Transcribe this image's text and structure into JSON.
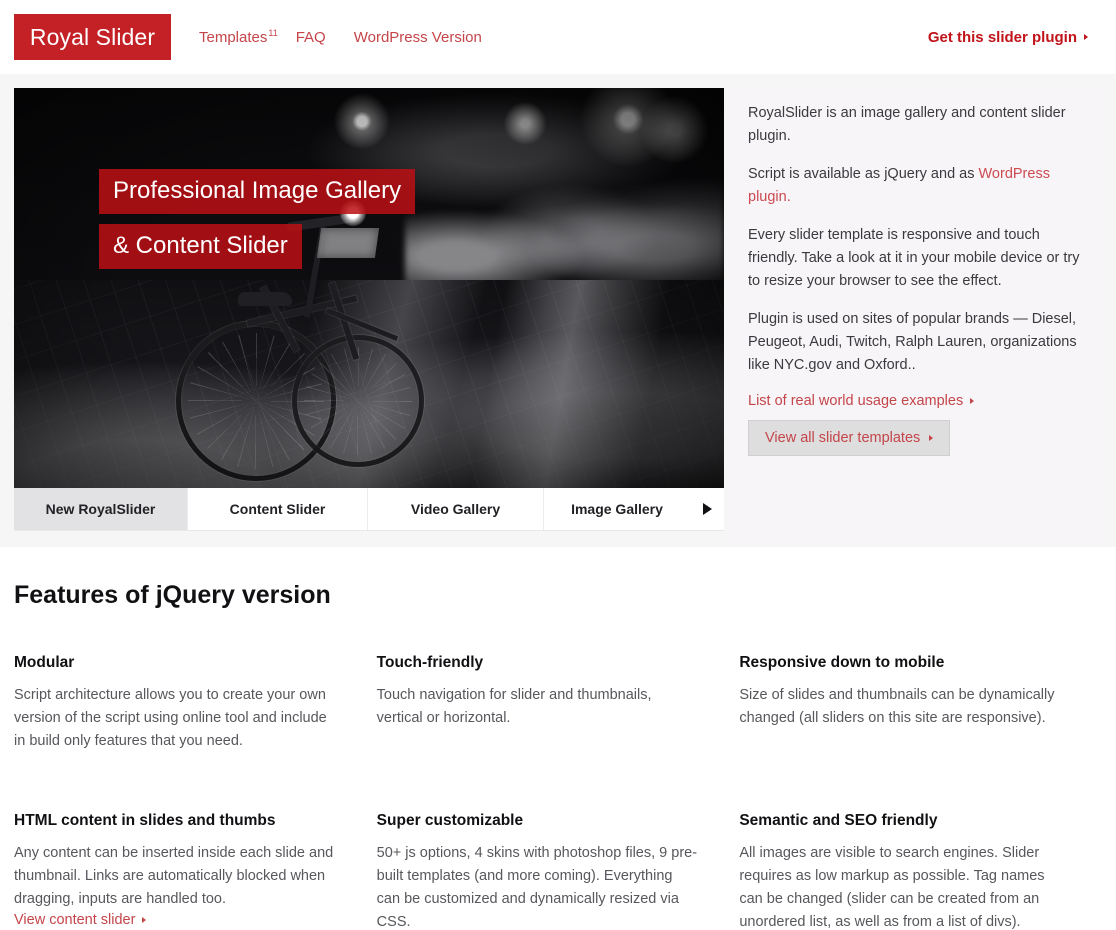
{
  "brand": {
    "logo_text": "Royal Slider",
    "logo_color": "#c42127",
    "link_color": "#c4454a"
  },
  "header": {
    "nav": [
      {
        "label": "Templates",
        "sup": "11"
      },
      {
        "label": "FAQ",
        "sup": ""
      },
      {
        "label": "WordPress Version",
        "sup": ""
      }
    ],
    "cta_label": "Get this slider plugin"
  },
  "slider": {
    "caption_line1": "Professional Image Gallery",
    "caption_line2": "& Content Slider",
    "tabs": [
      {
        "label": "New RoyalSlider",
        "active": true
      },
      {
        "label": "Content Slider",
        "active": false
      },
      {
        "label": "Video Gallery",
        "active": false
      },
      {
        "label": "Image Gallery",
        "active": false
      }
    ],
    "next_arrow": "triangle-right-icon"
  },
  "side": {
    "p1": "RoyalSlider is an image gallery and content slider plugin.",
    "p2_prefix": "Script is available as jQuery and as ",
    "p2_link": "WordPress plugin.",
    "p3": "Every slider template is responsive and touch friendly. Take a look at it in your mobile device or try to resize your browser to see the effect.",
    "p4": "Plugin is used on sites of popular brands — Diesel, Peugeot, Audi, Twitch, Ralph Lauren, organizations like NYC.gov and Oxford..",
    "usage_link": "List of real world usage examples",
    "templates_button": "View all slider templates"
  },
  "features": {
    "title": "Features of jQuery version",
    "items": [
      {
        "heading": "Modular",
        "body": "Script architecture allows you to create your own version of the script using online tool and include in build only features that you need.",
        "link": ""
      },
      {
        "heading": "Touch-friendly",
        "body": "Touch navigation for slider and thumbnails, vertical or horizontal.",
        "link": ""
      },
      {
        "heading": "Responsive down to mobile",
        "body": "Size of slides and thumbnails can be dynamically changed (all sliders on this site are responsive).",
        "link": ""
      },
      {
        "heading": "HTML content in slides and thumbs",
        "body": "Any content can be inserted inside each slide and thumbnail. Links are automatically blocked when dragging, inputs are handled too.",
        "link": "View content slider"
      },
      {
        "heading": "Super customizable",
        "body": "50+ js options, 4 skins with photoshop files, 9 pre-built templates (and more coming). Everything can be customized and dynamically resized via CSS.",
        "link": ""
      },
      {
        "heading": "Semantic and SEO friendly",
        "body": "All images are visible to search engines. Slider requires as low markup as possible. Tag names can be changed (slider can be created from an unordered list, as well as from a list of divs).",
        "link": ""
      }
    ]
  }
}
